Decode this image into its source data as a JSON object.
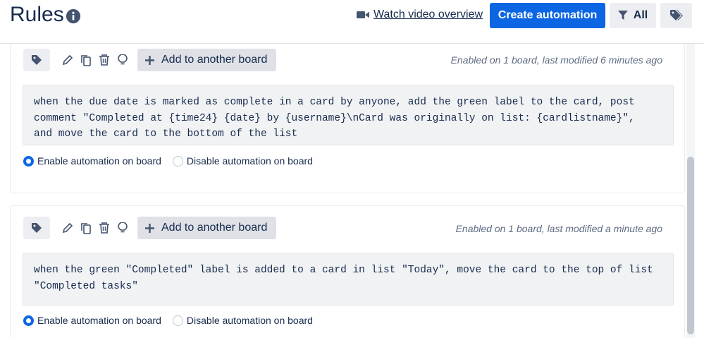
{
  "header": {
    "title": "Rules",
    "watch_label": "Watch video overview",
    "create_label": "Create automation",
    "filter_label": "All"
  },
  "rules": [
    {
      "add_board_label": "Add to another board",
      "meta": "Enabled on 1 board, last modified 6 minutes ago",
      "text": "when the due date is marked as complete in a card by anyone, add the green label to the card, post\ncomment \"Completed at {time24} {date} by {username}\\nCard was originally on list: {cardlistname}\",\nand move the card to the bottom of the list",
      "enable_label": "Enable automation on board",
      "disable_label": "Disable automation on board",
      "enabled": true
    },
    {
      "add_board_label": "Add to another board",
      "meta": "Enabled on 1 board, last modified a minute ago",
      "text": "when the green \"Completed\" label is added to a card in list \"Today\", move the card to the top of list\n\"Completed tasks\"",
      "enable_label": "Enable automation on board",
      "disable_label": "Disable automation on board",
      "enabled": true
    }
  ],
  "colors": {
    "primary": "#0c66e4",
    "text": "#172b4d",
    "muted": "#5e6c84",
    "button_bg": "#eceef1"
  }
}
